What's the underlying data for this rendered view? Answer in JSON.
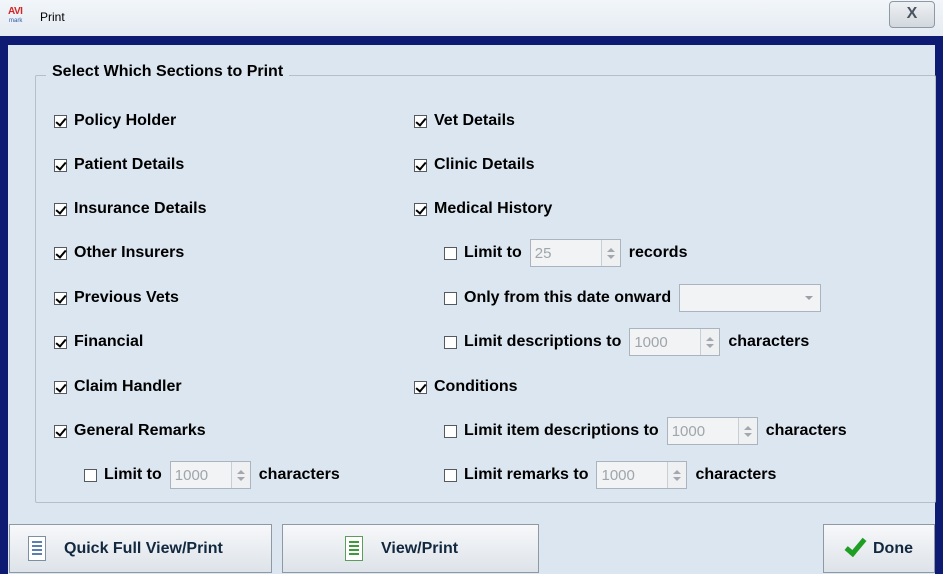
{
  "window": {
    "title": "Print",
    "logo_text": "AVI",
    "logo_sub": "mark",
    "close_glyph": "X"
  },
  "group": {
    "label": "Select Which Sections to Print"
  },
  "left_column": {
    "policy_holder": {
      "label": "Policy Holder",
      "checked": true
    },
    "patient_details": {
      "label": "Patient Details",
      "checked": true
    },
    "insurance_details": {
      "label": "Insurance Details",
      "checked": true
    },
    "other_insurers": {
      "label": "Other Insurers",
      "checked": true
    },
    "previous_vets": {
      "label": "Previous Vets",
      "checked": true
    },
    "financial": {
      "label": "Financial",
      "checked": true
    },
    "claim_handler": {
      "label": "Claim Handler",
      "checked": true
    },
    "general_remarks": {
      "label": "General Remarks",
      "checked": true
    },
    "remarks_limit": {
      "label": "Limit to",
      "checked": false,
      "value": "1000",
      "suffix": "characters"
    }
  },
  "right_column": {
    "vet_details": {
      "label": "Vet Details",
      "checked": true
    },
    "clinic_details": {
      "label": "Clinic Details",
      "checked": true
    },
    "medical_history": {
      "label": "Medical History",
      "checked": true
    },
    "limit_records": {
      "label": "Limit to",
      "checked": false,
      "value": "25",
      "suffix": "records"
    },
    "date_onward": {
      "label": "Only from this date onward",
      "checked": false,
      "value": ""
    },
    "limit_descriptions": {
      "label": "Limit descriptions to",
      "checked": false,
      "value": "1000",
      "suffix": "characters"
    },
    "conditions": {
      "label": "Conditions",
      "checked": true
    },
    "limit_item_descriptions": {
      "label": "Limit item descriptions to",
      "checked": false,
      "value": "1000",
      "suffix": "characters"
    },
    "limit_remarks": {
      "label": "Limit remarks to",
      "checked": false,
      "value": "1000",
      "suffix": "characters"
    }
  },
  "buttons": {
    "quick_full": "Quick Full View/Print",
    "view_print": "View/Print",
    "done": "Done"
  },
  "icons": {
    "quick_full": "document-icon",
    "view_print": "green-document-icon",
    "done": "green-check-icon"
  },
  "colors": {
    "frame": "#0d1b72",
    "client": "#dbe6f0",
    "check_green": "#1e9e22"
  }
}
